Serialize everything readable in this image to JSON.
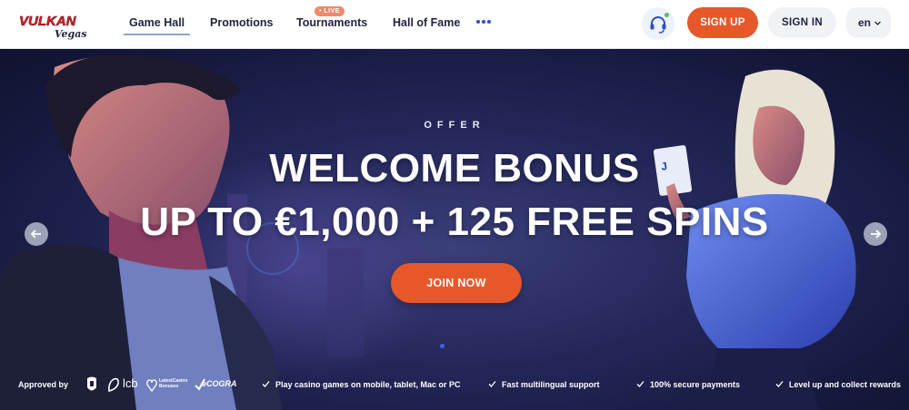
{
  "header": {
    "logo": {
      "line1": "VULKAN",
      "line2": "Vegas"
    },
    "nav": [
      {
        "label": "Game Hall",
        "active": true
      },
      {
        "label": "Promotions",
        "active": false
      },
      {
        "label": "Tournaments",
        "active": false,
        "badge": "• LIVE"
      },
      {
        "label": "Hall of Fame",
        "active": false
      }
    ],
    "more_icon": "more-dots-icon",
    "support_icon": "headset-icon",
    "signup_label": "SIGN UP",
    "signin_label": "SIGN IN",
    "language": "en",
    "colors": {
      "accent": "#e6582a",
      "nav_text": "#1e2340",
      "more_dots": "#2e4bd1"
    }
  },
  "hero": {
    "kicker": "OFFER",
    "headline_line1": "WELCOME BONUS",
    "headline_line2": "UP TO €1,000 + 125 FREE SPINS",
    "cta_label": "JOIN NOW",
    "prev_icon": "arrow-left-icon",
    "next_icon": "arrow-right-icon",
    "slides_total": 3,
    "active_slide": 1,
    "colors": {
      "background": "#24285a",
      "cta": "#e6582a",
      "active_dot": "#3f63e0"
    }
  },
  "trust": {
    "approved_label": "Approved by",
    "licenses": [
      {
        "icon": "shield-crest-icon"
      },
      {
        "icon": "lcb-icon",
        "text": "lcb"
      },
      {
        "icon": "latest-casino-bonuses-icon",
        "text_line1": "LatestCasino",
        "text_line2": "Bonuses"
      },
      {
        "icon": "ecogra-icon",
        "text": "eCOGRA"
      }
    ],
    "features": [
      "Play casino games on mobile, tablet, Mac or PC",
      "Fast multilingual support",
      "100% secure payments",
      "Level up and collect rewards"
    ]
  }
}
